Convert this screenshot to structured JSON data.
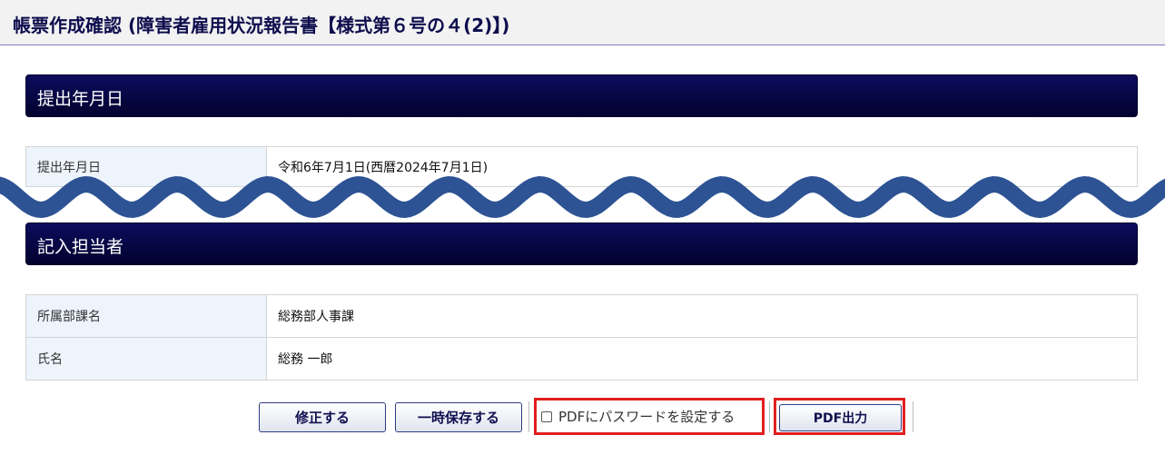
{
  "header": {
    "title": "帳票作成確認 (障害者雇用状況報告書【様式第６号の４(2)】)"
  },
  "sections": [
    {
      "title": "提出年月日",
      "rows": [
        {
          "label": "提出年月日",
          "value": "令和6年7月1日(西暦2024年7月1日)"
        }
      ]
    },
    {
      "title": "記入担当者",
      "rows": [
        {
          "label": "所属部課名",
          "value": "総務部人事課"
        },
        {
          "label": "氏名",
          "value": "総務 一郎"
        }
      ]
    }
  ],
  "actions": {
    "fix_label": "修正する",
    "temp_save_label": "一時保存する",
    "pdf_password_label": "PDFにパスワードを設定する",
    "pdf_password_checked": false,
    "pdf_output_label": "PDF出力"
  },
  "colors": {
    "section_bar": "#0c0c5e",
    "highlight": "#e01f1f",
    "wave": "#2d5394"
  },
  "decorations": {
    "wave_icon": "wavy-divider"
  }
}
